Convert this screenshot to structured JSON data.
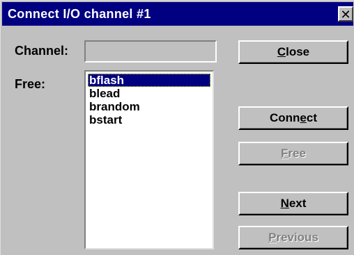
{
  "window": {
    "title": "Connect I/O channel #1",
    "close_glyph": "✕"
  },
  "form": {
    "channel_label": "Channel:",
    "channel_value": "",
    "free_label": "Free:"
  },
  "list": {
    "items": [
      {
        "label": "bflash",
        "selected": true
      },
      {
        "label": "blead",
        "selected": false
      },
      {
        "label": "brandom",
        "selected": false
      },
      {
        "label": "bstart",
        "selected": false
      }
    ]
  },
  "buttons": {
    "close": {
      "pre": "",
      "accel": "C",
      "post": "lose",
      "enabled": true
    },
    "connect": {
      "pre": "Conn",
      "accel": "e",
      "post": "ct",
      "enabled": true
    },
    "free": {
      "pre": "",
      "accel": "F",
      "post": "ree",
      "enabled": false
    },
    "next": {
      "pre": "",
      "accel": "N",
      "post": "ext",
      "enabled": true
    },
    "previous": {
      "pre": "",
      "accel": "P",
      "post": "revious",
      "enabled": false
    }
  },
  "colors": {
    "titlebar": "#000080",
    "face": "#c0c0c0",
    "selection": "#000080"
  }
}
